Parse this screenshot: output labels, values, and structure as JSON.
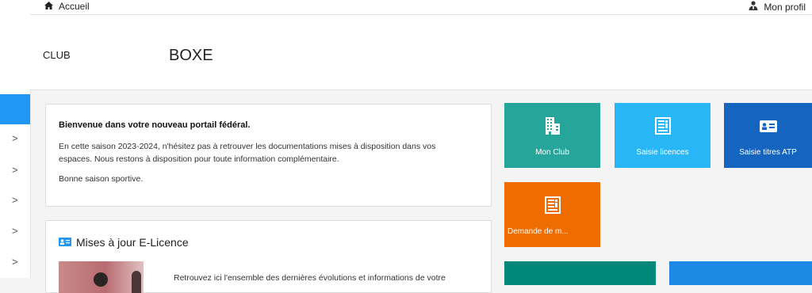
{
  "topbar": {
    "home_label": "Accueil",
    "profile_label": "Mon profil"
  },
  "header": {
    "club_label": "CLUB",
    "club_name": "BOXE"
  },
  "sidebar": {
    "chevrons": [
      ">",
      ">",
      ">",
      ">",
      ">"
    ]
  },
  "welcome": {
    "title": "Bienvenue dans votre nouveau portail fédéral.",
    "paragraph": "En cette saison 2023-2024, n'hésitez pas à retrouver les documentations mises à disposition dans vos espaces. Nous restons à disposition pour toute information complémentaire.",
    "closing": "Bonne saison sportive."
  },
  "updates": {
    "title": "Mises à jour E-Licence",
    "description": "Retrouvez ici l'ensemble des dernières évolutions et informations de votre"
  },
  "tiles": [
    {
      "label": "Mon Club",
      "icon": "building-icon",
      "color": "#26a69a"
    },
    {
      "label": "Saisie licences",
      "icon": "document-icon",
      "color": "#29b6f6"
    },
    {
      "label": "Saisie titres ATP",
      "icon": "id-card-icon",
      "color": "#1565c0"
    },
    {
      "label": "Demande de m...",
      "icon": "document-icon",
      "color": "#ef6c00"
    }
  ],
  "colors": {
    "sidebar_active": "#2196f3",
    "teal_tile": "#00897b",
    "blue_tile": "#1e88e5"
  }
}
